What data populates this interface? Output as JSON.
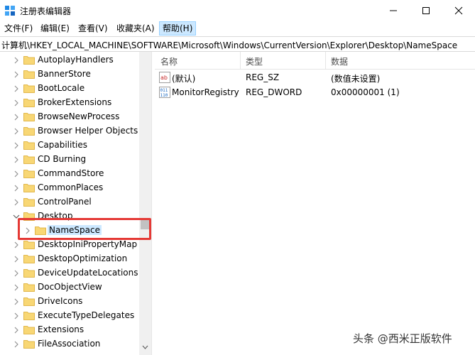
{
  "window": {
    "title": "注册表编辑器"
  },
  "menu": {
    "items": [
      {
        "label": "文件(F)"
      },
      {
        "label": "编辑(E)"
      },
      {
        "label": "查看(V)"
      },
      {
        "label": "收藏夹(A)"
      },
      {
        "label": "帮助(H)",
        "active": true
      }
    ]
  },
  "address": {
    "path": "计算机\\HKEY_LOCAL_MACHINE\\SOFTWARE\\Microsoft\\Windows\\CurrentVersion\\Explorer\\Desktop\\NameSpace"
  },
  "tree": {
    "items": [
      {
        "label": "AutoplayHandlers",
        "expanded": false
      },
      {
        "label": "BannerStore",
        "expanded": false
      },
      {
        "label": "BootLocale",
        "expanded": false
      },
      {
        "label": "BrokerExtensions",
        "expanded": false
      },
      {
        "label": "BrowseNewProcess",
        "expanded": false
      },
      {
        "label": "Browser Helper Objects",
        "expanded": false
      },
      {
        "label": "Capabilities",
        "expanded": false
      },
      {
        "label": "CD Burning",
        "expanded": false
      },
      {
        "label": "CommandStore",
        "expanded": false
      },
      {
        "label": "CommonPlaces",
        "expanded": false
      },
      {
        "label": "ControlPanel",
        "expanded": false
      },
      {
        "label": "Desktop",
        "expanded": true
      },
      {
        "label": "NameSpace",
        "expanded": false,
        "selected": true,
        "child": true
      },
      {
        "label": "DesktopIniPropertyMap",
        "expanded": false
      },
      {
        "label": "DesktopOptimization",
        "expanded": false
      },
      {
        "label": "DeviceUpdateLocations",
        "expanded": false
      },
      {
        "label": "DocObjectView",
        "expanded": false
      },
      {
        "label": "DriveIcons",
        "expanded": false
      },
      {
        "label": "ExecuteTypeDelegates",
        "expanded": false
      },
      {
        "label": "Extensions",
        "expanded": false
      },
      {
        "label": "FileAssociation",
        "expanded": false
      }
    ]
  },
  "list": {
    "columns": [
      "名称",
      "类型",
      "数据"
    ],
    "rows": [
      {
        "name": "(默认)",
        "type": "REG_SZ",
        "data": "(数值未设置)",
        "icon": "string-value-icon"
      },
      {
        "name": "MonitorRegistry",
        "type": "REG_DWORD",
        "data": "0x00000001 (1)",
        "icon": "binary-value-icon"
      }
    ]
  },
  "watermark": {
    "text": "头条 @西米正版软件"
  },
  "colors": {
    "selection": "#cce8ff",
    "folder": "#f8d775",
    "highlight_box": "#e53935"
  }
}
